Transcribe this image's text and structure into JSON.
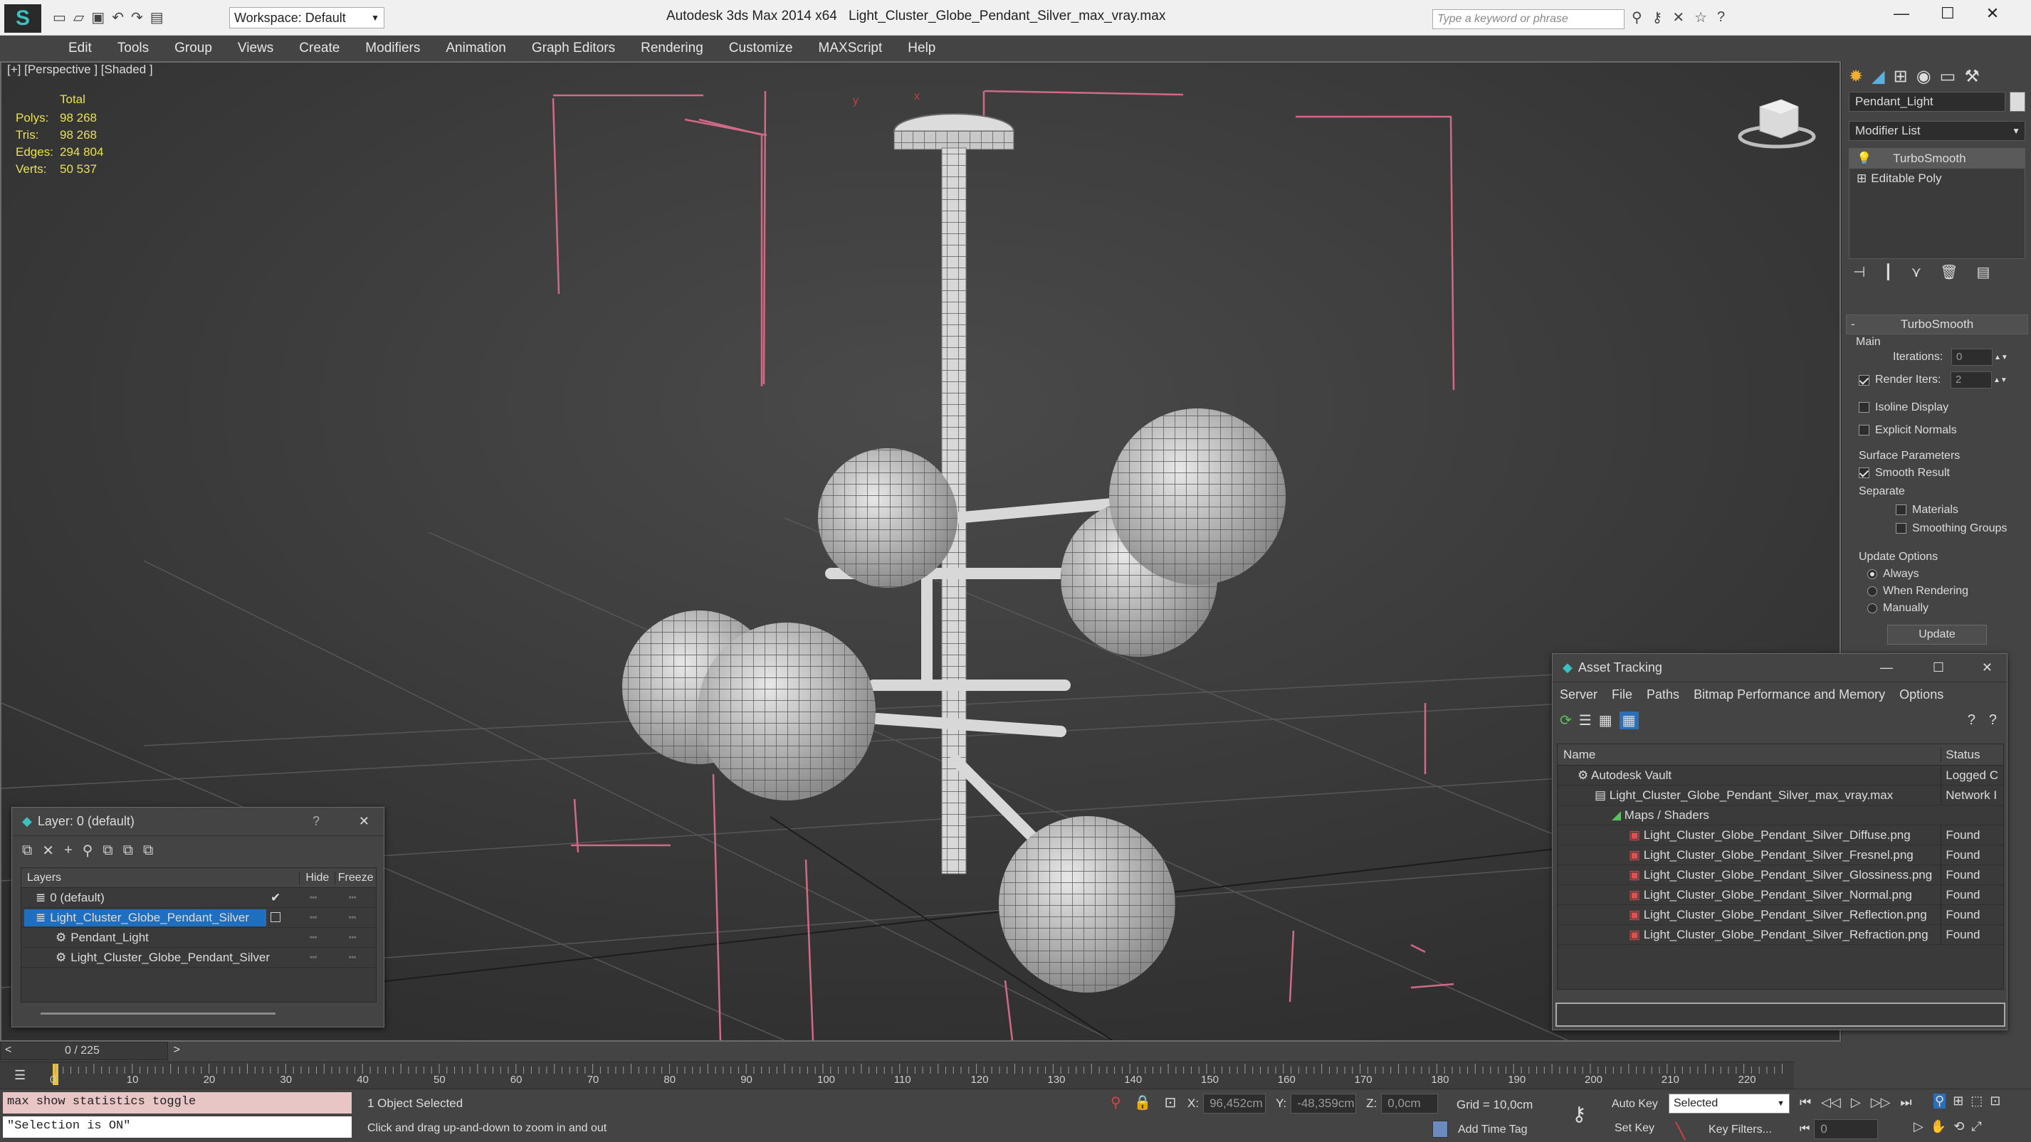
{
  "titlebar": {
    "workspace": "Workspace: Default",
    "app_title": "Autodesk 3ds Max  2014 x64",
    "file_title": "Light_Cluster_Globe_Pendant_Silver_max_vray.max",
    "search_placeholder": "Type a keyword or phrase"
  },
  "menu": [
    "Edit",
    "Tools",
    "Group",
    "Views",
    "Create",
    "Modifiers",
    "Animation",
    "Graph Editors",
    "Rendering",
    "Customize",
    "MAXScript",
    "Help"
  ],
  "viewport": {
    "label": "[+] [Perspective ] [Shaded ]",
    "stats": {
      "total_label": "Total",
      "rows": [
        {
          "label": "Polys:",
          "value": "98 268"
        },
        {
          "label": "Tris:",
          "value": "98 268"
        },
        {
          "label": "Edges:",
          "value": "294 804"
        },
        {
          "label": "Verts:",
          "value": "50 537"
        }
      ]
    },
    "axis_x": "x",
    "axis_y": "y"
  },
  "cmdpanel": {
    "object_name": "Pendant_Light",
    "modifier_list": "Modifier List",
    "stack": [
      "TurboSmooth",
      "Editable Poly"
    ],
    "rollout_title": "TurboSmooth",
    "main_label": "Main",
    "iterations_label": "Iterations:",
    "iterations_value": "0",
    "render_iters_label": "Render Iters:",
    "render_iters_value": "2",
    "isoline": "Isoline Display",
    "explicit_normals": "Explicit Normals",
    "surface_params": "Surface Parameters",
    "smooth_result": "Smooth Result",
    "separate": "Separate",
    "materials": "Materials",
    "smoothing_groups": "Smoothing Groups",
    "update_options": "Update Options",
    "always": "Always",
    "when_rendering": "When Rendering",
    "manually": "Manually",
    "update_button": "Update"
  },
  "layer_window": {
    "title": "Layer: 0 (default)",
    "help": "?",
    "col_layers": "Layers",
    "col_hide": "Hide",
    "col_freeze": "Freeze",
    "rows": [
      {
        "name": "0 (default)",
        "indent": 1,
        "selected": false
      },
      {
        "name": "Light_Cluster_Globe_Pendant_Silver",
        "indent": 1,
        "selected": true
      },
      {
        "name": "Pendant_Light",
        "indent": 2,
        "selected": false
      },
      {
        "name": "Light_Cluster_Globe_Pendant_Silver",
        "indent": 2,
        "selected": false
      }
    ]
  },
  "asset_window": {
    "title": "Asset Tracking",
    "menu": [
      "Server",
      "File",
      "Paths",
      "Bitmap Performance and Memory",
      "Options"
    ],
    "col_name": "Name",
    "col_status": "Status",
    "rows": [
      {
        "name": "Autodesk Vault",
        "status": "Logged C",
        "indent": 1
      },
      {
        "name": "Light_Cluster_Globe_Pendant_Silver_max_vray.max",
        "status": "Network I",
        "indent": 2
      },
      {
        "name": "Maps / Shaders",
        "status": "",
        "indent": 3
      },
      {
        "name": "Light_Cluster_Globe_Pendant_Silver_Diffuse.png",
        "status": "Found",
        "indent": 4
      },
      {
        "name": "Light_Cluster_Globe_Pendant_Silver_Fresnel.png",
        "status": "Found",
        "indent": 4
      },
      {
        "name": "Light_Cluster_Globe_Pendant_Silver_Glossiness.png",
        "status": "Found",
        "indent": 4
      },
      {
        "name": "Light_Cluster_Globe_Pendant_Silver_Normal.png",
        "status": "Found",
        "indent": 4
      },
      {
        "name": "Light_Cluster_Globe_Pendant_Silver_Reflection.png",
        "status": "Found",
        "indent": 4
      },
      {
        "name": "Light_Cluster_Globe_Pendant_Silver_Refraction.png",
        "status": "Found",
        "indent": 4
      }
    ]
  },
  "timeline": {
    "frame_counter": "0 / 225",
    "ticks": [
      "0",
      "10",
      "20",
      "30",
      "40",
      "50",
      "60",
      "70",
      "80",
      "90",
      "100",
      "110",
      "120",
      "130",
      "140",
      "150",
      "160",
      "170",
      "180",
      "190",
      "200",
      "210",
      "220"
    ]
  },
  "status": {
    "script_line1": "max show statistics toggle",
    "script_line2": "\"Selection is ON\"",
    "selected": "1 Object Selected",
    "hint": "Click and drag up-and-down to zoom in and out",
    "x_label": "X:",
    "x_value": "96,452cm",
    "y_label": "Y:",
    "y_value": "-48,359cm",
    "z_label": "Z:",
    "z_value": "0,0cm",
    "grid": "Grid = 10,0cm",
    "add_time_tag": "Add Time Tag",
    "auto_key": "Auto Key",
    "set_key": "Set Key",
    "key_mode": "Selected",
    "key_filters": "Key Filters...",
    "frame_value": "0"
  }
}
